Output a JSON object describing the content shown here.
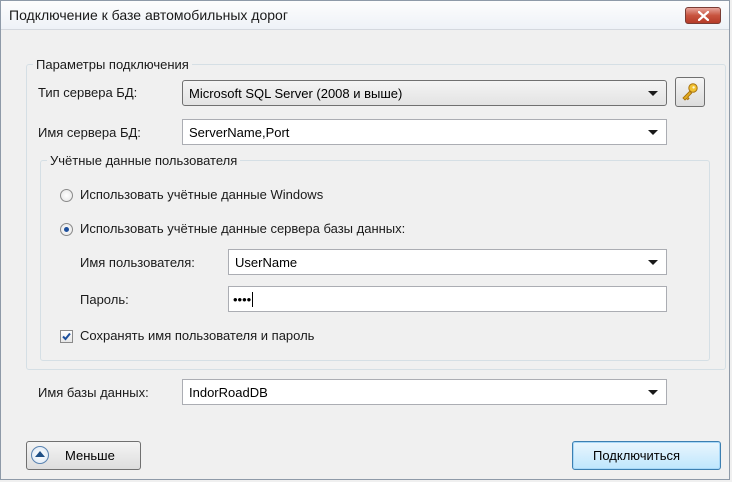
{
  "window": {
    "title": "Подключение к базе автомобильных дорог"
  },
  "connection": {
    "group_label": "Параметры подключения",
    "server_type_label": "Тип сервера БД:",
    "server_type_value": "Microsoft SQL Server (2008 и выше)",
    "server_name_label": "Имя сервера БД:",
    "server_name_value": "ServerName,Port"
  },
  "credentials": {
    "group_label": "Учётные данные пользователя",
    "windows_auth_label": "Использовать учётные данные Windows",
    "server_auth_label": "Использовать учётные данные сервера базы данных:",
    "selected_auth": "server",
    "username_label": "Имя пользователя:",
    "username_value": "UserName",
    "password_label": "Пароль:",
    "password_masked": "••••",
    "save_label": "Сохранять имя пользователя и пароль",
    "save_checked": true
  },
  "database": {
    "label": "Имя базы данных:",
    "value": "IndorRoadDB"
  },
  "footer": {
    "less_label": "Меньше",
    "connect_label": "Подключиться"
  },
  "icons": {
    "close": "close-icon",
    "browse": "key-icon",
    "less": "chevron-up-circle-icon"
  }
}
